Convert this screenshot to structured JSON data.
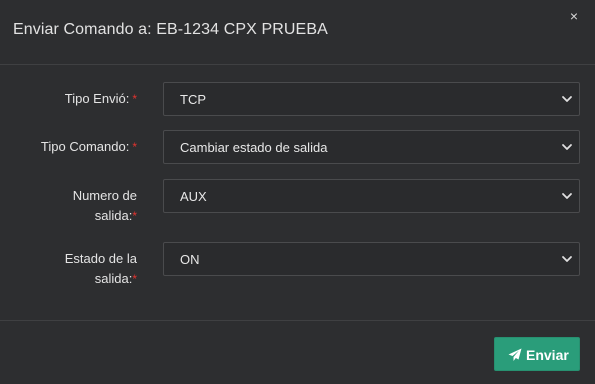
{
  "modal": {
    "title": "Enviar Comando a: EB-1234 CPX PRUEBA",
    "close_glyph": "×"
  },
  "form": {
    "tipo_envio": {
      "label": "Tipo Envió:",
      "required_mark": "*",
      "selected": "TCP"
    },
    "tipo_comando": {
      "label": "Tipo Comando:",
      "required_mark": "*",
      "selected": "Cambiar estado de salida"
    },
    "numero_salida": {
      "label_line1": "Numero de",
      "label_line2": "salida:",
      "required_mark": "*",
      "selected": "AUX"
    },
    "estado_salida": {
      "label_line1": "Estado de la",
      "label_line2": "salida:",
      "required_mark": "*",
      "selected": "ON"
    }
  },
  "footer": {
    "send_label": "Enviar",
    "send_icon": "paper-plane-icon"
  },
  "colors": {
    "background": "#2d2e30",
    "required": "#e3342f",
    "primary_button": "#2a9d7a"
  }
}
